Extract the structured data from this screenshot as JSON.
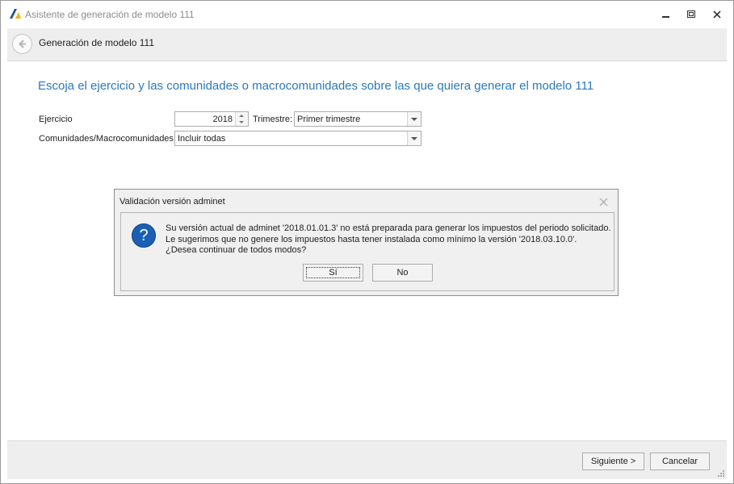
{
  "window": {
    "title": "Asistente de generación de modelo 111",
    "controls": [
      "minimize-icon",
      "maximize-icon",
      "close-icon"
    ]
  },
  "header": {
    "back_icon": "back-arrow-icon",
    "title": "Generación de modelo 111"
  },
  "main": {
    "heading": "Escoja el ejercicio y las comunidades o macrocomunidades sobre las que quiera generar el modelo 111",
    "ejercicio_label": "Ejercicio",
    "ejercicio_value": "2018",
    "trimestre_label": "Trimestre:",
    "trimestre_value": "Primer trimestre",
    "comunidades_label": "Comunidades/Macrocomunidades:",
    "comunidades_value": "Incluir todas"
  },
  "dialog": {
    "title": "Validación versión adminet",
    "icon": "question-icon",
    "message_lines": [
      "Su versión actual de adminet '2018.01.01.3' no está preparada para generar los impuestos del periodo solicitado.",
      "Le sugerimos que no genere los impuestos hasta tener instalada como mínimo la versión '2018.03.10.0'.",
      "¿Desea continuar de todos modos?"
    ],
    "yes_label": "Sí",
    "no_label": "No"
  },
  "footer": {
    "next_label": "Siguiente >",
    "cancel_label": "Cancelar"
  },
  "colors": {
    "accent": "#2a7ab8",
    "question_icon": "#1a5fb4",
    "panel": "#eeeeee"
  }
}
